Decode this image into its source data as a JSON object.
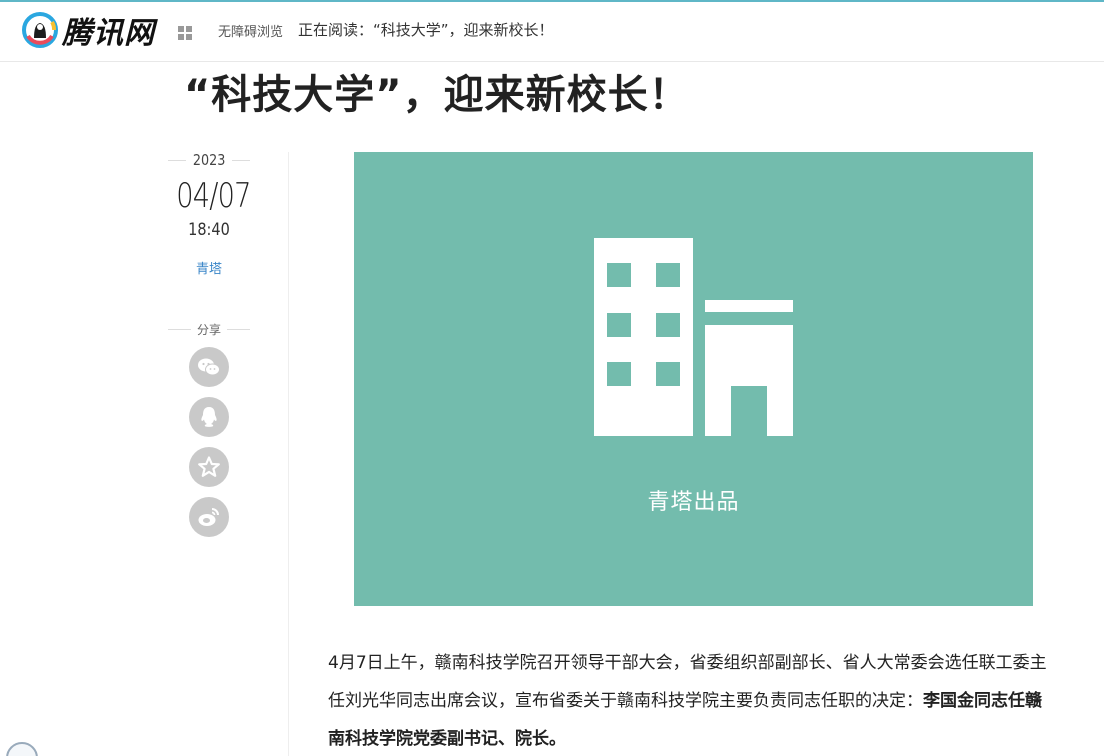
{
  "header": {
    "logo_text": "腾讯网",
    "grid_icon": "grid-icon",
    "accessibility_label": "无障碍浏览",
    "reading_label": "正在阅读：“科技大学”，迎来新校长！"
  },
  "article": {
    "title": "“科技大学”，迎来新校长！",
    "year": "2023",
    "date": "04/07",
    "time": "18:40",
    "source": "青塔",
    "share_label": "分享",
    "share_buttons": [
      "wechat-icon",
      "qq-icon",
      "favorite-star-icon",
      "weibo-icon"
    ],
    "cover_caption": "青塔出品",
    "paragraph_normal": "4月7日上午，赣南科技学院召开领导干部大会，省委组织部副部长、省人大常委会选任联工委主任刘光华同志出席会议，宣布省委关于赣南科技学院主要负责同志任职的决定：",
    "paragraph_bold": "李国金同志任赣南科技学院党委副书记、院长。"
  },
  "colors": {
    "cover_bg": "#73bcad",
    "source_link": "#3a86c8",
    "share_button_bg": "#c9c9c9"
  }
}
